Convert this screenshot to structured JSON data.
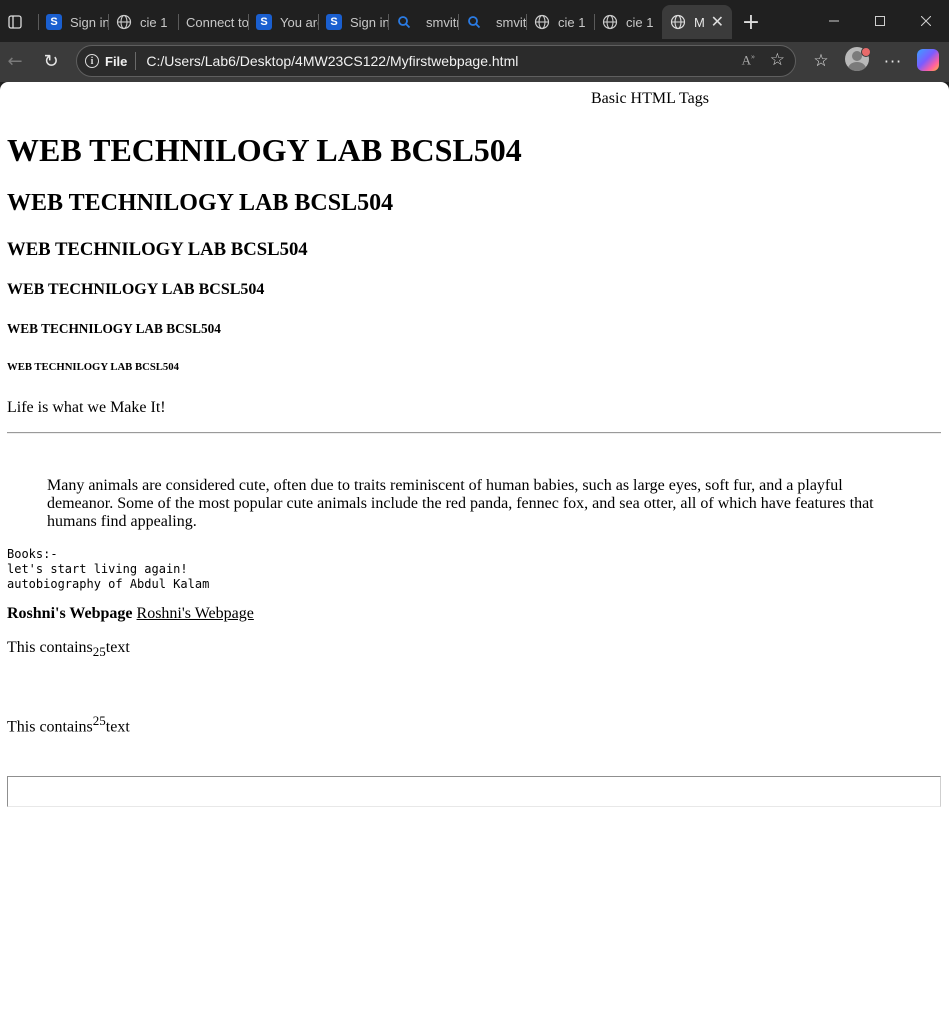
{
  "browser": {
    "tabs": [
      {
        "title": "Sign in",
        "icon": "s-icon"
      },
      {
        "title": "cie 1",
        "icon": "globe-icon"
      },
      {
        "title": "Connect to",
        "icon": ""
      },
      {
        "title": "You are",
        "icon": "s-icon"
      },
      {
        "title": "Sign in",
        "icon": "s-icon"
      },
      {
        "title": "smvitm",
        "icon": "search-icon"
      },
      {
        "title": "smvitm",
        "icon": "search-icon"
      },
      {
        "title": "cie 1",
        "icon": "globe-icon"
      },
      {
        "title": "cie 1",
        "icon": "globe-icon"
      },
      {
        "title": "M",
        "icon": "globe-icon",
        "active": true
      }
    ],
    "address": {
      "scheme": "File",
      "url": "C:/Users/Lab6/Desktop/4MW23CS122/Myfirstwebpage.html"
    }
  },
  "page": {
    "marquee": "Basic HTML Tags",
    "heading": "WEB TECHNILOGY LAB BCSL504",
    "paragraph": "Life is what we Make It!",
    "blockquote": "Many animals are considered cute, often due to traits reminiscent of human babies, such as large eyes, soft fur, and a playful demeanor. Some of the most popular cute animals include the red panda, fennec fox, and sea otter, all of which have features that humans find appealing.",
    "pre": "Books:-\nlet's start living again!\nautobiography of Abdul Kalam",
    "bold_text": "Roshni's Webpage",
    "link_text": "Roshni's Webpage",
    "sub_line": {
      "before": "This contains",
      "script": "25",
      "after": "text"
    },
    "sup_line": {
      "before": "This contains",
      "script": "25",
      "after": "text"
    },
    "textbox_value": ""
  }
}
